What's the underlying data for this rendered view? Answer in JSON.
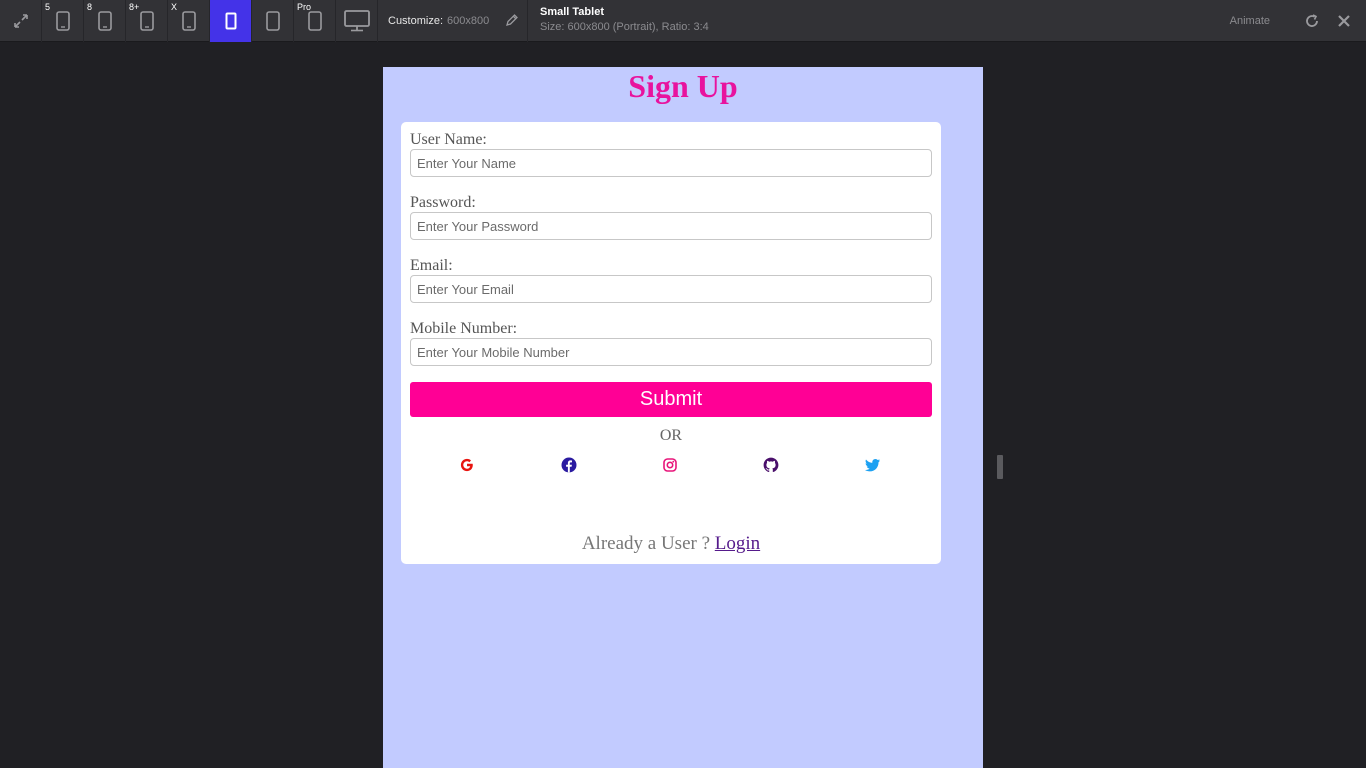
{
  "toolbar": {
    "devices": [
      {
        "badge": ""
      },
      {
        "badge": "5"
      },
      {
        "badge": "8"
      },
      {
        "badge": "8+"
      },
      {
        "badge": "X"
      },
      {
        "badge": ""
      },
      {
        "badge": ""
      },
      {
        "badge": "Pro"
      },
      {
        "badge": ""
      }
    ],
    "customize_label": "Customize:",
    "customize_value": "600x800",
    "device_name": "Small Tablet",
    "device_size": "Size: 600x800 (Portrait), Ratio: 3:4",
    "animate_label": "Animate",
    "accent_color": "#4433e8"
  },
  "page": {
    "title": "Sign Up",
    "title_color": "#e8139e",
    "background_color": "#c2cbff",
    "fields": [
      {
        "label": "User Name:",
        "placeholder": "Enter Your Name"
      },
      {
        "label": "Password:",
        "placeholder": "Enter Your Password"
      },
      {
        "label": "Email:",
        "placeholder": "Enter Your Email"
      },
      {
        "label": "Mobile Number:",
        "placeholder": "Enter Your Mobile Number"
      }
    ],
    "submit_label": "Submit",
    "submit_color": "#ff0095",
    "or_text": "OR",
    "socials": [
      {
        "icon": "google-icon",
        "color": "#e8140f"
      },
      {
        "icon": "facebook-icon",
        "color": "#2a1aa0"
      },
      {
        "icon": "instagram-icon",
        "color": "#e8157a"
      },
      {
        "icon": "github-icon",
        "color": "#4a0f6b"
      },
      {
        "icon": "twitter-icon",
        "color": "#1da1f2"
      }
    ],
    "already_text": "Already a User ?",
    "login_link": "Login"
  }
}
